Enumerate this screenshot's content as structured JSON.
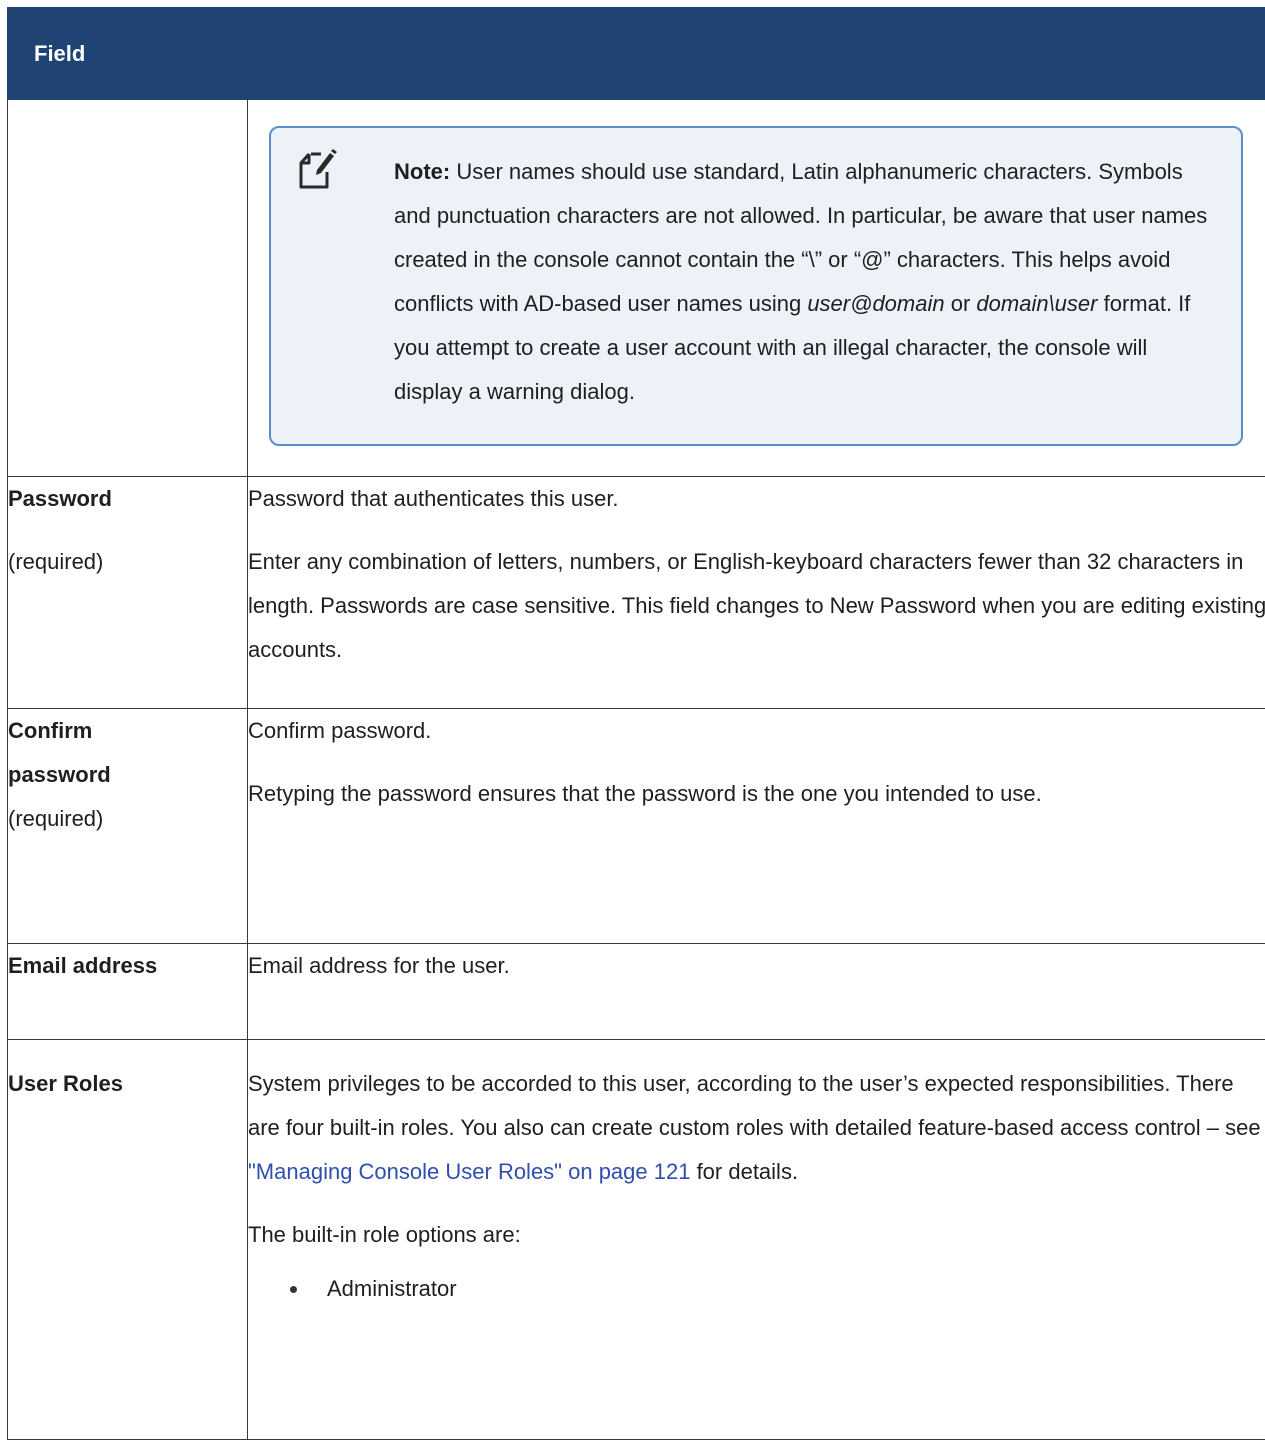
{
  "table": {
    "header": {
      "col1": "Field",
      "col2": ""
    },
    "note": {
      "label": "Note:",
      "text_1": " User names should use standard, Latin alphanumeric characters. Symbols and punctuation characters are not allowed. In particular, be aware that user names created in the console cannot contain the “\\” or “@” characters. This helps avoid conflicts with AD-based user names using ",
      "em_1": "user@domain",
      "text_2": " or ",
      "em_2": "domain\\user",
      "text_3": " format. If you attempt to create a user account with an illegal character, the console will display a warning dialog.",
      "icon": "note-pencil-icon"
    },
    "rows": [
      {
        "name": "Password",
        "required": "(required)",
        "paragraphs": [
          "Password that authenticates this user.",
          "Enter any combination of letters, numbers, or English-keyboard characters fewer than 32 characters in length. Passwords are case sensitive. This field changes to New Password when you are editing existing accounts."
        ]
      },
      {
        "name": "Confirm password",
        "required": "(required)",
        "paragraphs": [
          "Confirm password.",
          "Retyping the password ensures that the password is the one you intended to use."
        ]
      },
      {
        "name": "Email address",
        "paragraphs": [
          "Email address for the user."
        ]
      },
      {
        "name": "User Roles",
        "intro_1": "System privileges to be accorded to this user, according to the user’s expected responsibilities. There are four built-in roles. You also can create custom roles with detailed feature-based access control – see ",
        "link": "\"Managing Console User Roles\" on page 121",
        "intro_2": " for details.",
        "options_label": "The built-in role options are:",
        "options": [
          "Administrator"
        ]
      }
    ]
  },
  "colors": {
    "header_bg": "#1f4473",
    "note_bg": "#edf2f8",
    "note_border": "#5b8fc9",
    "link": "#2f4fb0"
  }
}
